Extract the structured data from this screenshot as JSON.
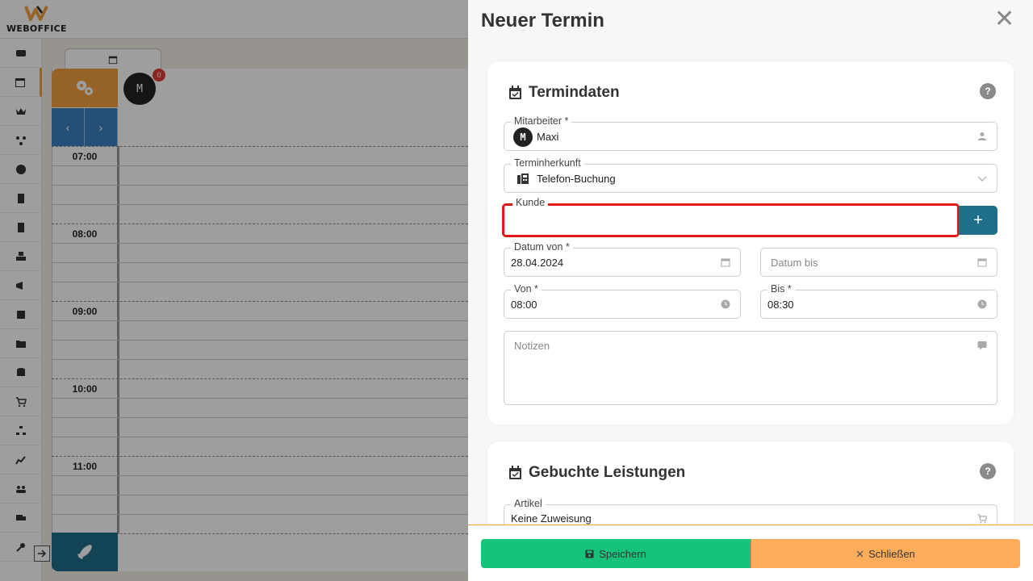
{
  "app": {
    "logo_text": "WEBOFFICE"
  },
  "calendar": {
    "hours": [
      "07:00",
      "08:00",
      "09:00",
      "10:00",
      "11:00"
    ],
    "employee_initial": "M",
    "employee_badge": "0",
    "nav_prev": "‹",
    "nav_next": "›"
  },
  "panel": {
    "title": "Neuer Termin",
    "close_glyph": "✕"
  },
  "termindaten": {
    "title": "Termindaten",
    "help": "?",
    "mitarbeiter": {
      "label": "Mitarbeiter *",
      "avatar": "M",
      "value": "Maxi"
    },
    "terminherkunft": {
      "label": "Terminherkunft",
      "value": "Telefon-Buchung"
    },
    "kunde": {
      "label": "Kunde",
      "add": "+"
    },
    "datum_von": {
      "label": "Datum von *",
      "value": "28.04.2024"
    },
    "datum_bis": {
      "placeholder": "Datum bis"
    },
    "von": {
      "label": "Von *",
      "value": "08:00"
    },
    "bis": {
      "label": "Bis *",
      "value": "08:30"
    },
    "notizen": {
      "placeholder": "Notizen"
    }
  },
  "leistungen": {
    "title": "Gebuchte Leistungen",
    "help": "?",
    "artikel": {
      "label": "Artikel",
      "value": "Keine Zuweisung"
    }
  },
  "actions": {
    "save": "Speichern",
    "close": "Schließen"
  },
  "colors": {
    "accent_orange": "#f0a040",
    "save_green": "#17c37b",
    "close_orange": "#ffad5b",
    "kunde_highlight": "#e01818",
    "add_button": "#1f6f8b"
  }
}
